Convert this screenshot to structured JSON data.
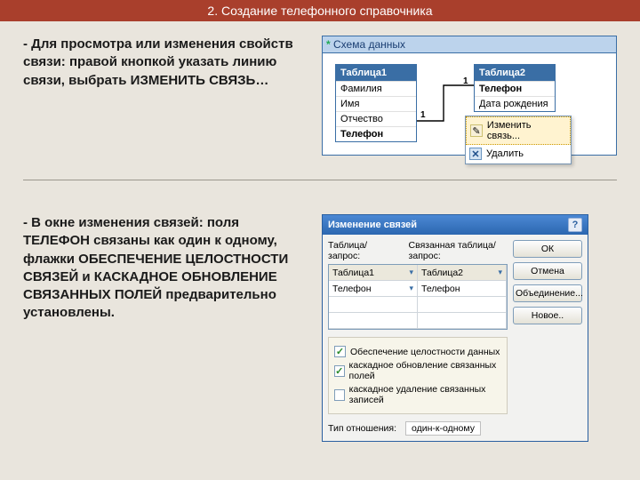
{
  "title": "2. Создание телефонного справочника",
  "explain1": " - Для просмотра или изменения свойств связи: правой кнопкой указать линию связи, выбрать ИЗМЕНИТЬ СВЯЗЬ…",
  "explain2": " - В окне изменения связей: поля ТЕЛЕФОН связаны как один к одному, флажки ОБЕСПЕЧЕНИЕ ЦЕЛОСТНОСТИ СВЯЗЕЙ  и КАСКАДНОЕ ОБНОВЛЕНИЕ СВЯЗАННЫХ ПОЛЕЙ предварительно установлены.",
  "schema": {
    "caption": "Схема данных",
    "table1": {
      "name": "Таблица1",
      "fields": [
        "Фамилия",
        "Имя",
        "Отчество",
        "Телефон"
      ]
    },
    "table2": {
      "name": "Таблица2",
      "fields": [
        "Телефон",
        "Дата рождения"
      ]
    },
    "one": "1",
    "menu": {
      "edit": "Изменить связь...",
      "del": "Удалить"
    }
  },
  "dlg": {
    "title": "Изменение связей",
    "label_left": "Таблица/запрос:",
    "label_right": "Связанная таблица/запрос:",
    "t1": "Таблица1",
    "t2": "Таблица2",
    "f1": "Телефон",
    "f2": "Телефон",
    "chk1": "Обеспечение целостности данных",
    "chk2": "каскадное обновление связанных полей",
    "chk3": "каскадное удаление связанных записей",
    "rel_label": "Тип отношения:",
    "rel_value": "один-к-одному",
    "btn_ok": "ОК",
    "btn_cancel": "Отмена",
    "btn_join": "Объединение...",
    "btn_new": "Новое..",
    "help": "?"
  }
}
